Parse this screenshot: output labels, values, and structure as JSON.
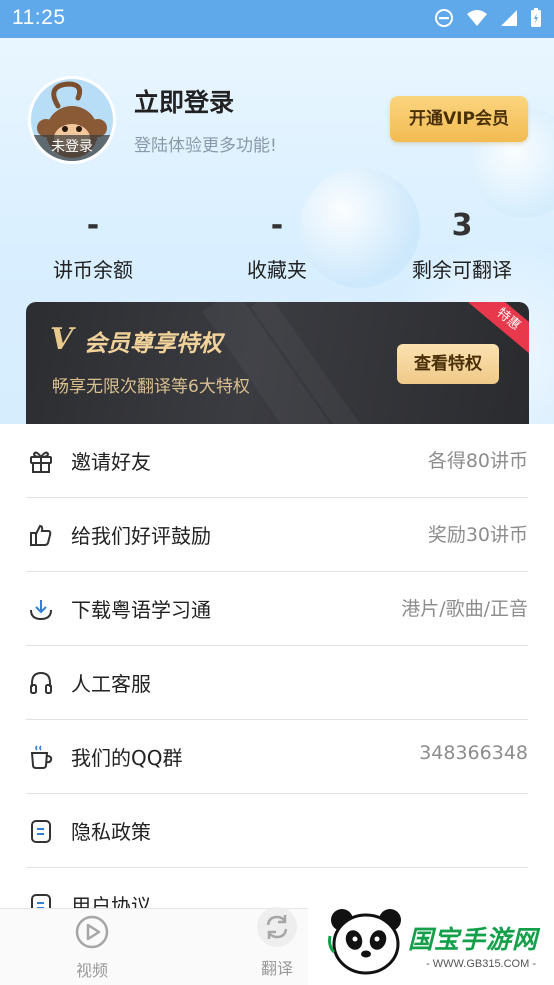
{
  "status_bar": {
    "time": "11:25"
  },
  "profile": {
    "avatar_badge": "未登录",
    "login_title": "立即登录",
    "login_subtitle": "登陆体验更多功能!",
    "vip_button": "开通VIP会员"
  },
  "stats": [
    {
      "value": "-",
      "label": "讲币余额"
    },
    {
      "value": "-",
      "label": "收藏夹"
    },
    {
      "value": "3",
      "label": "剩余可翻译"
    }
  ],
  "vip_card": {
    "logo": "V",
    "title": "会员尊享特权",
    "description": "畅享无限次翻译等6大特权",
    "button": "查看特权",
    "tag": "特惠"
  },
  "menu": [
    {
      "icon": "gift-icon",
      "label": "邀请好友",
      "value": "各得80讲币"
    },
    {
      "icon": "thumbs-up-icon",
      "label": "给我们好评鼓励",
      "value": "奖励30讲币"
    },
    {
      "icon": "download-icon",
      "label": "下载粤语学习通",
      "value": "港片/歌曲/正音"
    },
    {
      "icon": "headphones-icon",
      "label": "人工客服",
      "value": ""
    },
    {
      "icon": "coffee-cup-icon",
      "label": "我们的QQ群",
      "value": "348366348"
    },
    {
      "icon": "document-icon",
      "label": "隐私政策",
      "value": ""
    },
    {
      "icon": "document-icon",
      "label": "用户协议",
      "value": ""
    }
  ],
  "bottom_nav": [
    {
      "icon": "play-icon",
      "label": "视频"
    },
    {
      "icon": "refresh-icon",
      "label": "翻译"
    }
  ],
  "watermark": {
    "brand": "国宝手游网",
    "site": "- WWW.GB315.COM -"
  },
  "colors": {
    "status_bar": "#5fa8ea",
    "vip_gold": "#f2bb52",
    "accent_blue": "#4a90d9"
  }
}
